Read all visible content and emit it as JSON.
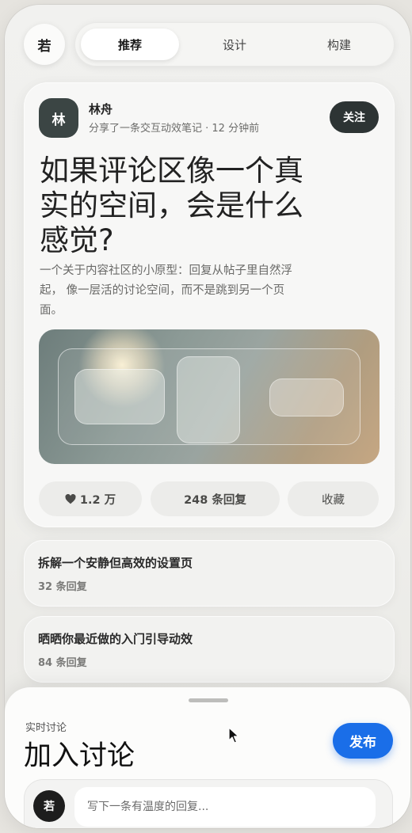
{
  "header": {
    "avatar_text": "若",
    "tabs": [
      {
        "label": "推荐",
        "active": true
      },
      {
        "label": "设计",
        "active": false
      },
      {
        "label": "构建",
        "active": false
      }
    ]
  },
  "post": {
    "author_initial": "林",
    "author_name": "林舟",
    "meta": "分享了一条交互动效笔记 · 12 分钟前",
    "follow_label": "关注",
    "title": "如果评论区像一个真实的空间，会是什么感觉?",
    "summary": "一个关于内容社区的小原型：回复从帖子里自然浮起， 像一层活的讨论空间，而不是跳到另一个页面。",
    "likes": "1.2 万",
    "replies": "248 条回复",
    "save_label": "收藏"
  },
  "threads": [
    {
      "title": "拆解一个安静但高效的设置页",
      "count": "32 条回复"
    },
    {
      "title": "晒晒你最近做的入门引导动效",
      "count": "84 条回复"
    }
  ],
  "sheet": {
    "label": "实时讨论",
    "title": "加入讨论",
    "publish_label": "发布",
    "composer_avatar": "若",
    "placeholder": "写下一条有温度的回复..."
  },
  "colors": {
    "accent": "#1a6ee8",
    "follow_button": "#2d3434",
    "author_avatar": "#3b4544"
  },
  "icons": [
    "heart-icon",
    "pointer-cursor-icon"
  ]
}
